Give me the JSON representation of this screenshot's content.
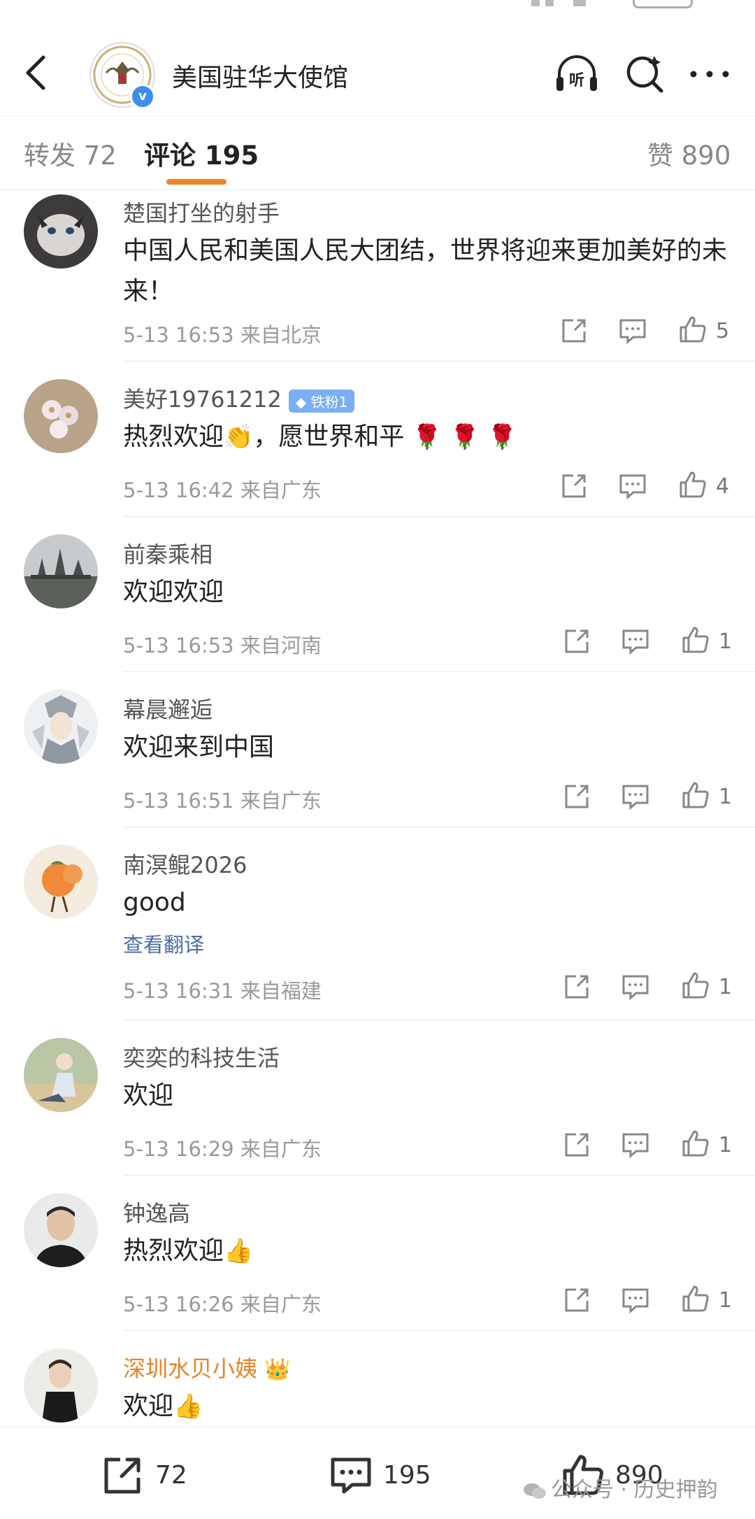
{
  "header": {
    "title": "美国驻华大使馆",
    "verified_mark": "v"
  },
  "tabs": {
    "repost": "转发 72",
    "comments": "评论 195",
    "likes": "赞 890"
  },
  "comments": [
    {
      "name": "楚国打坐的射手",
      "text": "中国人民和美国人民大团结，世界将迎来更加美好的未来！",
      "meta": "5-13 16:53  来自北京",
      "likes": "5"
    },
    {
      "name": "美好19761212",
      "badge": "铁粉1",
      "text_a": "热烈欢迎",
      "text_b": "，愿世界和平",
      "meta": "5-13 16:42  来自广东",
      "likes": "4"
    },
    {
      "name": "前秦乘相",
      "text": "欢迎欢迎",
      "meta": "5-13 16:53  来自河南",
      "likes": "1"
    },
    {
      "name": "幕晨邂逅",
      "text": "欢迎来到中国",
      "meta": "5-13 16:51  来自广东",
      "likes": "1"
    },
    {
      "name": "南溟鲲2026",
      "text": "good",
      "translate": "查看翻译",
      "meta": "5-13 16:31  来自福建",
      "likes": "1"
    },
    {
      "name": "奕奕的科技生活",
      "text": "欢迎",
      "meta": "5-13 16:29  来自广东",
      "likes": "1"
    },
    {
      "name": "钟逸高",
      "text": "热烈欢迎",
      "meta": "5-13 16:26  来自广东",
      "likes": "1"
    },
    {
      "name": "深圳水贝小姨",
      "text": "欢迎"
    }
  ],
  "emoji": {
    "clap": "👏",
    "rose": "🌹",
    "thumbs": "👍",
    "crown": "👑"
  },
  "bottom_bar": {
    "repost_count": "72",
    "comment_count": "195",
    "like_count": "890"
  },
  "watermark": "公众号 · 历史押韵",
  "colors": {
    "accent": "#f08328",
    "link": "#4a6ea8",
    "badge": "#7aaef5",
    "verified": "#3d8ee8"
  }
}
